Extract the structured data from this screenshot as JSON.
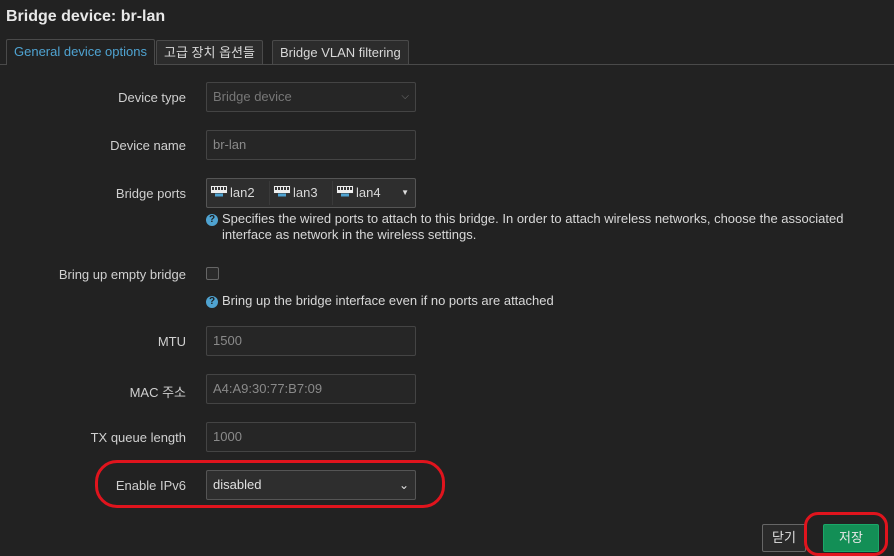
{
  "dialog": {
    "title": "Bridge device: br-lan"
  },
  "tabs": [
    {
      "label": "General device options",
      "active": true
    },
    {
      "label": "고급 장치 옵션들",
      "active": false
    },
    {
      "label": "Bridge VLAN filtering",
      "active": false
    }
  ],
  "form": {
    "device_type": {
      "label": "Device type",
      "value": "Bridge device"
    },
    "device_name": {
      "label": "Device name",
      "value": "br-lan"
    },
    "bridge_ports": {
      "label": "Bridge ports",
      "ports": [
        "lan2",
        "lan3",
        "lan4"
      ],
      "help": "Specifies the wired ports to attach to this bridge. In order to attach wireless networks, choose the associated",
      "help_line2": "interface as network in the wireless settings."
    },
    "bring_up_empty": {
      "label": "Bring up empty bridge",
      "checked": false,
      "help": "Bring up the bridge interface even if no ports are attached"
    },
    "mtu": {
      "label": "MTU",
      "placeholder": "1500"
    },
    "mac": {
      "label": "MAC 주소",
      "placeholder": "A4:A9:30:77:B7:09"
    },
    "txqueuelen": {
      "label": "TX queue length",
      "placeholder": "1000"
    },
    "ipv6": {
      "label": "Enable IPv6",
      "value": "disabled"
    }
  },
  "footer": {
    "close_label": "닫기",
    "save_label": "저장"
  },
  "colors": {
    "background": "#222222",
    "accent": "#4fa3d1",
    "save_button": "#138f56",
    "annotation": "#e0141d"
  },
  "icons": {
    "port": "ethernet-port-icon",
    "help": "help-icon",
    "caret": "chevron-down-icon"
  }
}
